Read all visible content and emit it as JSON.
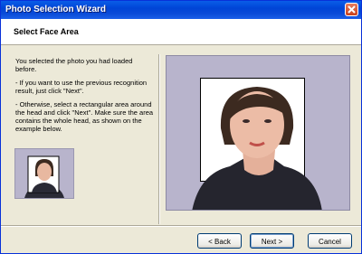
{
  "window": {
    "title": "Photo Selection Wizard"
  },
  "header": {
    "title": "Select Face Area"
  },
  "instructions": {
    "p1": "You selected the photo you had loaded before.",
    "p2": "- If you want to use the previous recognition result, just click \"Next\".",
    "p3": "- Otherwise, select a rectangular area around the head and click \"Next\". Make sure the area contains the whole head, as shown on the example below."
  },
  "buttons": {
    "back": "< Back",
    "next": "Next >",
    "cancel": "Cancel"
  },
  "colors": {
    "titlebar": "#0a4bd8",
    "panel": "#ece9d8",
    "photo_bg": "#b8b4cc"
  }
}
